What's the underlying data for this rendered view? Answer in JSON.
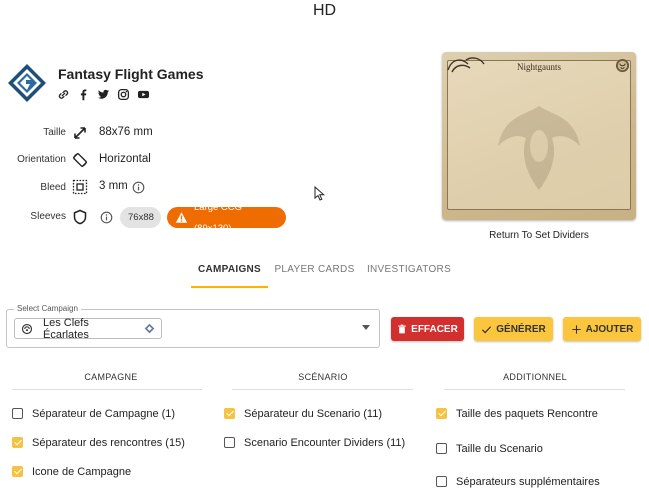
{
  "header": {
    "title": "HD"
  },
  "publisher": {
    "name": "Fantasy Flight Games"
  },
  "properties": {
    "size_label": "Taille",
    "size_value": "88x76 mm",
    "orientation_label": "Orientation",
    "orientation_value": "Horizontal",
    "bleed_label": "Bleed",
    "bleed_value": "3 mm",
    "sleeves_label": "Sleeves",
    "sleeve_chip_small": "76x88",
    "sleeve_chip_large": "Large CCG (89x130)"
  },
  "preview": {
    "card_title": "Nightgaunts",
    "caption": "Return To Set Dividers"
  },
  "tabs": [
    {
      "label": "CAMPAIGNS",
      "active": true
    },
    {
      "label": "PLAYER CARDS",
      "active": false
    },
    {
      "label": "INVESTIGATORS",
      "active": false
    }
  ],
  "campaign_select": {
    "legend": "Select Campaign",
    "value": "Les Clefs Écarlates"
  },
  "buttons": {
    "clear": "EFFACER",
    "generate": "GÉNÉRER",
    "add": "AJOUTER"
  },
  "columns": [
    {
      "title": "CAMPAGNE",
      "items": [
        {
          "label": "Séparateur de Campagne (1)",
          "checked": false
        },
        {
          "label": "Séparateur des rencontres (15)",
          "checked": true
        },
        {
          "label": "Icone de Campagne",
          "checked": true
        }
      ]
    },
    {
      "title": "SCÉNARIO",
      "items": [
        {
          "label": "Séparateur du Scenario (11)",
          "checked": true
        },
        {
          "label": "Scenario Encounter Dividers (11)",
          "checked": false
        }
      ]
    },
    {
      "title": "ADDITIONNEL",
      "items": [
        {
          "label": "Taille des paquets Rencontre",
          "checked": true
        },
        {
          "label": "Taille du Scenario",
          "checked": false
        },
        {
          "label": "Séparateurs supplémentaires",
          "checked": false
        }
      ]
    }
  ],
  "colors": {
    "accent": "#ffb300",
    "danger": "#d32f2f",
    "warning_chip": "#ef6c00",
    "checkbox_on": "#f5c242"
  },
  "icons": [
    "ffg-logo-icon",
    "link-icon",
    "facebook-icon",
    "twitter-icon",
    "instagram-icon",
    "youtube-icon",
    "resize-icon",
    "rotate-icon",
    "bleed-icon",
    "info-icon",
    "shield-icon",
    "warning-icon",
    "campaign-icon",
    "trash-icon",
    "check-icon",
    "plus-icon",
    "chevron-down-icon"
  ]
}
